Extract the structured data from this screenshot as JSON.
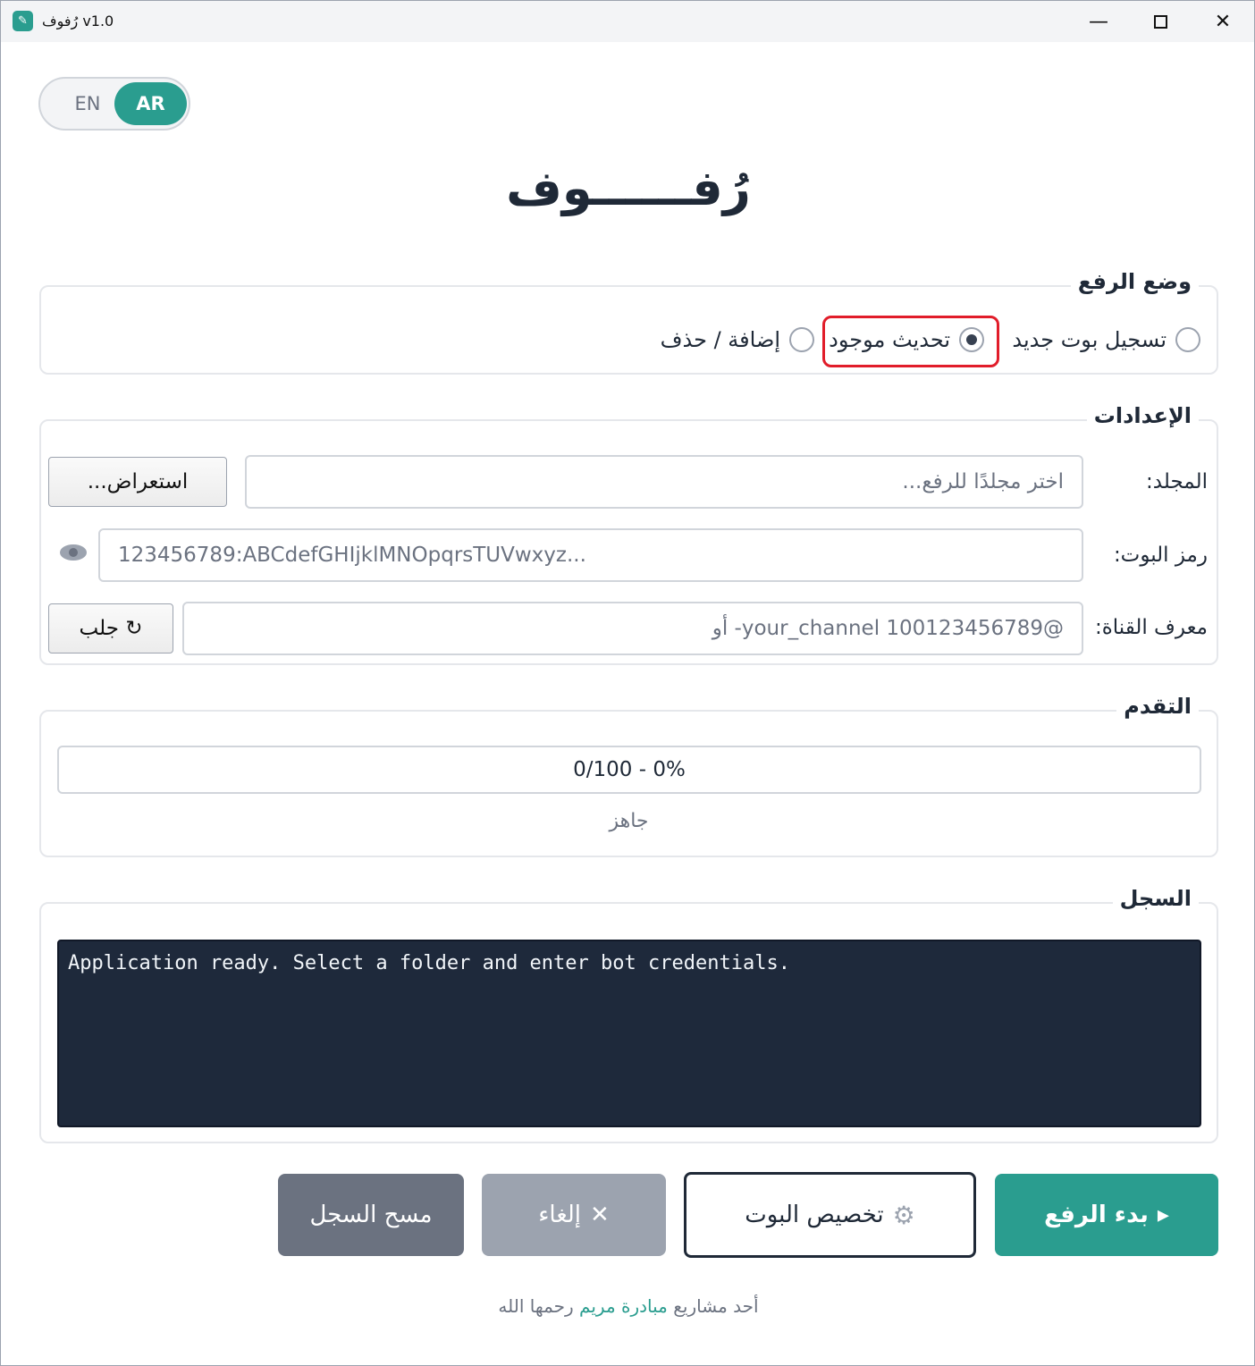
{
  "window": {
    "title": "رُفوف v1.0",
    "icon": "app-icon"
  },
  "lang": {
    "en": "EN",
    "ar": "AR",
    "active": "AR"
  },
  "app_title": "رُفــــــوف",
  "upload_mode": {
    "legend": "وضع الرفع",
    "options": [
      {
        "label": "تسجيل بوت جديد",
        "checked": false
      },
      {
        "label": "تحديث موجود",
        "checked": true
      },
      {
        "label": "إضافة / حذف",
        "checked": false
      }
    ]
  },
  "settings": {
    "legend": "الإعدادات",
    "folder_label": "المجلد:",
    "folder_placeholder": "اختر مجلدًا للرفع...",
    "browse_button": "استعراض...",
    "token_label": "رمز البوت:",
    "token_placeholder": "123456789:ABCdefGHIjklMNOpqrsTUVwxyz...",
    "channel_label": "معرف القناة:",
    "channel_placeholder": "@your_channel 100123456789- أو",
    "fetch_button": "↻ جلب"
  },
  "progress": {
    "legend": "التقدم",
    "text": "0/100 - 0%",
    "value": 0,
    "status": "جاهز"
  },
  "log": {
    "legend": "السجل",
    "text": "Application ready. Select a folder and enter bot credentials."
  },
  "actions": {
    "start": "بدء الرفع",
    "start_icon": "▸",
    "customize": "تخصيص البوت",
    "customize_icon": "⚙",
    "cancel": "إلغاء",
    "cancel_icon": "✕",
    "clear": "مسح السجل"
  },
  "footer": {
    "prefix": "أحد مشاريع",
    "link": "مبادرة مريم",
    "suffix": "رحمها الله"
  },
  "colors": {
    "accent": "#2a9d8f",
    "highlight": "#e11d2a",
    "log_bg": "#1e293b"
  }
}
